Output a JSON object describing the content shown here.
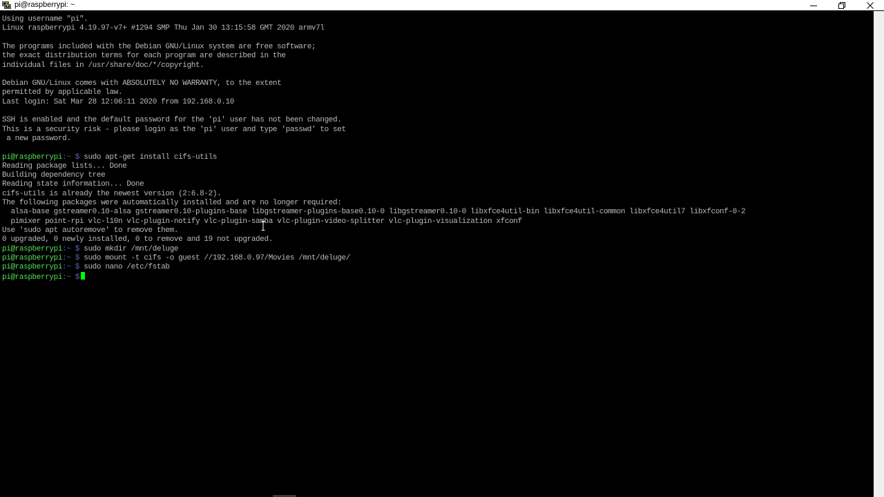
{
  "window": {
    "title": "pi@raspberrypi: ~"
  },
  "prompt": {
    "user_host": "pi@raspberrypi",
    "path_sep": ":~ $"
  },
  "lines": [
    {
      "text": "Using username \"pi\"."
    },
    {
      "text": "Linux raspberrypi 4.19.97-v7+ #1294 SMP Thu Jan 30 13:15:58 GMT 2020 armv7l"
    },
    {
      "text": ""
    },
    {
      "text": "The programs included with the Debian GNU/Linux system are free software;"
    },
    {
      "text": "the exact distribution terms for each program are described in the"
    },
    {
      "text": "individual files in /usr/share/doc/*/copyright."
    },
    {
      "text": ""
    },
    {
      "text": "Debian GNU/Linux comes with ABSOLUTELY NO WARRANTY, to the extent"
    },
    {
      "text": "permitted by applicable law."
    },
    {
      "text": "Last login: Sat Mar 28 12:06:11 2020 from 192.168.0.10"
    },
    {
      "text": ""
    },
    {
      "text": "SSH is enabled and the default password for the 'pi' user has not been changed."
    },
    {
      "text": "This is a security risk - please login as the 'pi' user and type 'passwd' to set"
    },
    {
      "text": " a new password."
    },
    {
      "text": ""
    },
    {
      "text": " sudo apt-get install cifs-utils",
      "prompt": true
    },
    {
      "text": "Reading package lists... Done"
    },
    {
      "text": "Building dependency tree"
    },
    {
      "text": "Reading state information... Done"
    },
    {
      "text": "cifs-utils is already the newest version (2:6.8-2)."
    },
    {
      "text": "The following packages were automatically installed and are no longer required:"
    },
    {
      "text": "  alsa-base gstreamer0.10-alsa gstreamer0.10-plugins-base libgstreamer-plugins-base0.10-0 libgstreamer0.10-0 libxfce4util-bin libxfce4util-common libxfce4util7 libxfconf-0-2"
    },
    {
      "text": "  pimixer point-rpi vlc-l10n vlc-plugin-notify vlc-plugin-samba vlc-plugin-video-splitter vlc-plugin-visualization xfconf"
    },
    {
      "text": "Use 'sudo apt autoremove' to remove them."
    },
    {
      "text": "0 upgraded, 0 newly installed, 0 to remove and 19 not upgraded."
    },
    {
      "text": " sudo mkdir /mnt/deluge",
      "prompt": true
    },
    {
      "text": " sudo mount -t cifs -o guest //192.168.0.97/Movies /mnt/deluge/",
      "prompt": true
    },
    {
      "text": " sudo nano /etc/fstab",
      "prompt": true
    },
    {
      "text": " ",
      "prompt": true,
      "cursor": true
    }
  ],
  "colors": {
    "prompt": "#55e055",
    "text": "#bbbbbb",
    "cursor": "#00ff00",
    "background": "#000000"
  }
}
